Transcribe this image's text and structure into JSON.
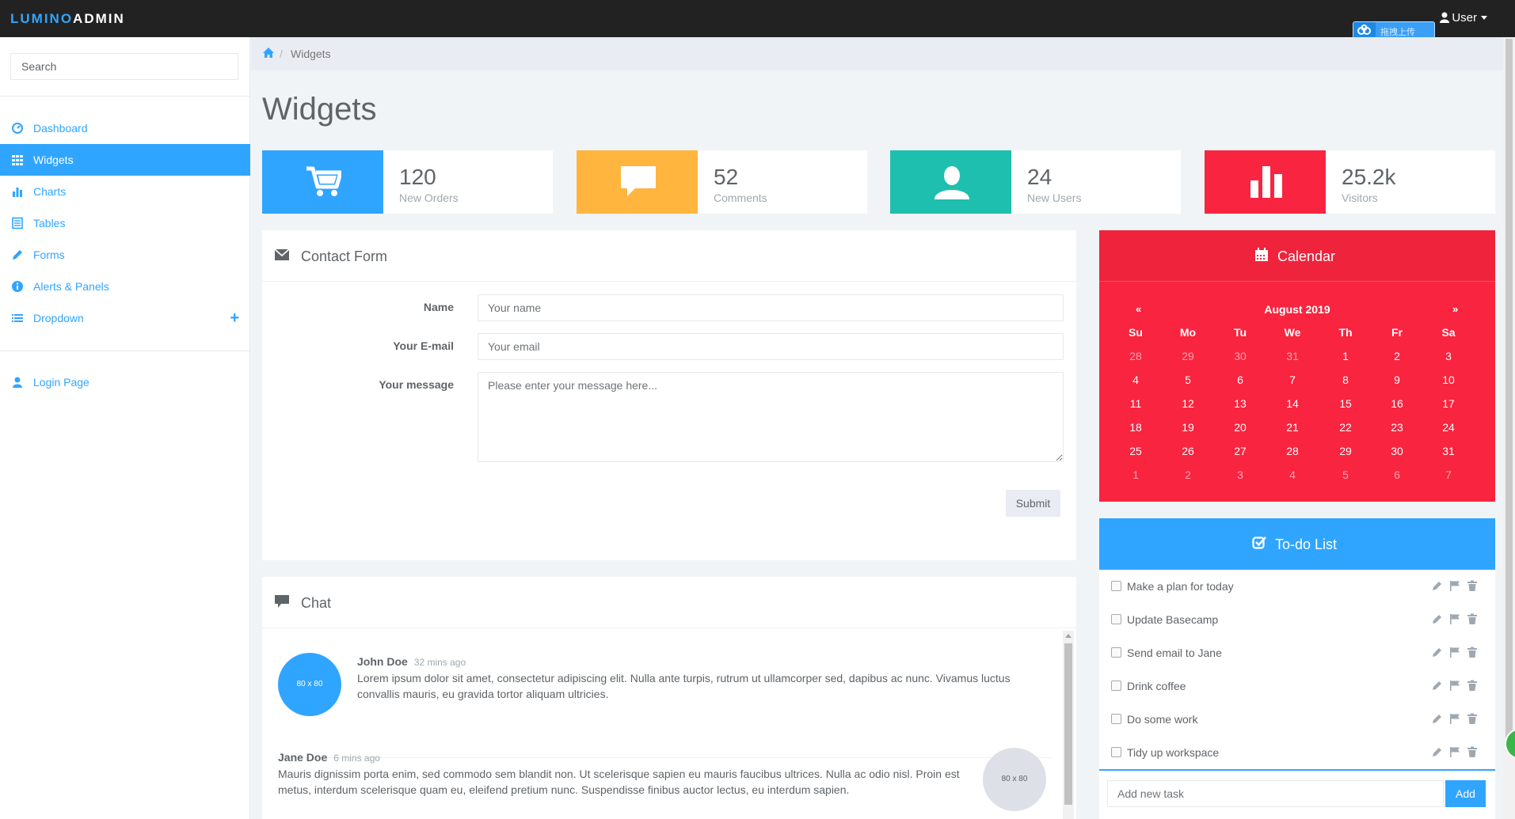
{
  "brand": {
    "part1": "LUMINO",
    "part2": "ADMIN"
  },
  "topbar": {
    "user_label": "User",
    "upload_label": "拖拽上传"
  },
  "sidebar": {
    "search_placeholder": "Search",
    "items": [
      {
        "label": "Dashboard",
        "icon": "dashboard-icon"
      },
      {
        "label": "Widgets",
        "icon": "grid-icon",
        "active": true
      },
      {
        "label": "Charts",
        "icon": "bar-chart-icon"
      },
      {
        "label": "Tables",
        "icon": "table-icon"
      },
      {
        "label": "Forms",
        "icon": "pencil-icon"
      },
      {
        "label": "Alerts & Panels",
        "icon": "info-icon"
      },
      {
        "label": "Dropdown",
        "icon": "list-icon"
      }
    ],
    "login": "Login Page"
  },
  "breadcrumb": {
    "current": "Widgets"
  },
  "page_title": "Widgets",
  "stats": [
    {
      "value": "120",
      "label": "New Orders",
      "color": "#30a5ff",
      "icon": "cart-icon"
    },
    {
      "value": "52",
      "label": "Comments",
      "color": "#ffb53e",
      "icon": "comment-icon"
    },
    {
      "value": "24",
      "label": "New Users",
      "color": "#1ebfae",
      "icon": "user-icon"
    },
    {
      "value": "25.2k",
      "label": "Visitors",
      "color": "#f9243f",
      "icon": "bar-chart-icon"
    }
  ],
  "contact": {
    "title": "Contact Form",
    "name_label": "Name",
    "name_placeholder": "Your name",
    "email_label": "Your E-mail",
    "email_placeholder": "Your email",
    "message_label": "Your message",
    "message_placeholder": "Please enter your message here...",
    "submit": "Submit"
  },
  "chat": {
    "title": "Chat",
    "messages": [
      {
        "name": "John Doe",
        "time": "32 mins ago",
        "text": "Lorem ipsum dolor sit amet, consectetur adipiscing elit. Nulla ante turpis, rutrum ut ullamcorper sed, dapibus ac nunc. Vivamus luctus convallis mauris, eu gravida tortor aliquam ultricies.",
        "avatar": "80 x 80",
        "avatar_color": "#30a5ff"
      },
      {
        "name": "Jane Doe",
        "time": "6 mins ago",
        "text": "Mauris dignissim porta enim, sed commodo sem blandit non. Ut scelerisque sapien eu mauris faucibus ultrices. Nulla ac odio nisl. Proin est metus, interdum scelerisque quam eu, eleifend pretium nunc. Suspendisse finibus auctor lectus, eu interdum sapien.",
        "avatar": "80 x 80",
        "avatar_color": "#dde0e6"
      }
    ]
  },
  "calendar": {
    "title": "Calendar",
    "month": "August 2019",
    "prev": "«",
    "next": "»",
    "days_of_week": [
      "Su",
      "Mo",
      "Tu",
      "We",
      "Th",
      "Fr",
      "Sa"
    ],
    "weeks": [
      [
        "28",
        "29",
        "30",
        "31",
        "1",
        "2",
        "3"
      ],
      [
        "4",
        "5",
        "6",
        "7",
        "8",
        "9",
        "10"
      ],
      [
        "11",
        "12",
        "13",
        "14",
        "15",
        "16",
        "17"
      ],
      [
        "18",
        "19",
        "20",
        "21",
        "22",
        "23",
        "24"
      ],
      [
        "25",
        "26",
        "27",
        "28",
        "29",
        "30",
        "31"
      ],
      [
        "1",
        "2",
        "3",
        "4",
        "5",
        "6",
        "7"
      ]
    ]
  },
  "todo": {
    "title": "To-do List",
    "items": [
      "Make a plan for today",
      "Update Basecamp",
      "Send email to Jane",
      "Drink coffee",
      "Do some work",
      "Tidy up workspace"
    ],
    "input_placeholder": "Add new task",
    "add": "Add"
  }
}
